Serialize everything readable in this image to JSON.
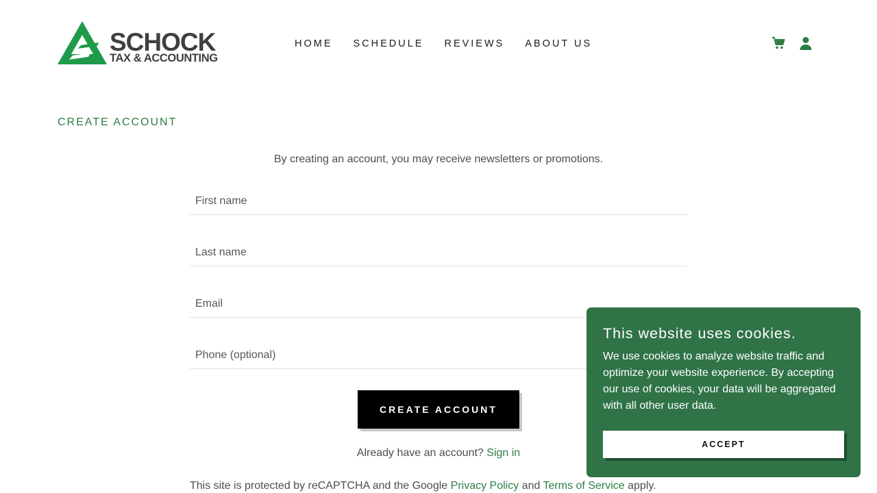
{
  "header": {
    "logo": {
      "brand": "SCHOCK",
      "tagline": "TAX & ACCOUNTING"
    },
    "nav": [
      "HOME",
      "SCHEDULE",
      "REVIEWS",
      "ABOUT US"
    ],
    "icons": [
      "cart-icon",
      "account-icon"
    ]
  },
  "main": {
    "title": "CREATE ACCOUNT",
    "intro": "By creating an account, you may receive newsletters or promotions.",
    "fields": {
      "first_name": {
        "placeholder": "First name",
        "value": ""
      },
      "last_name": {
        "placeholder": "Last name",
        "value": ""
      },
      "email": {
        "placeholder": "Email",
        "value": ""
      },
      "phone": {
        "placeholder": "Phone (optional)",
        "value": ""
      }
    },
    "submit_label": "CREATE ACCOUNT",
    "signin_prompt": "Already have an account?",
    "signin_link": "Sign in",
    "recaptcha": {
      "prefix": "This site is protected by reCAPTCHA and the Google",
      "privacy": "Privacy Policy",
      "and": "and",
      "terms": "Terms of Service",
      "suffix": "apply."
    }
  },
  "cookie_banner": {
    "title": "This website uses cookies.",
    "body": "We use cookies to analyze website traffic and optimize your website experience. By accepting our use of cookies, your data will be aggregated with all other user data.",
    "accept_label": "ACCEPT"
  },
  "colors": {
    "accent_green": "#2e7d45",
    "logo_green": "#1f9a4a",
    "banner_green": "#2f7347",
    "button_black": "#000000"
  }
}
